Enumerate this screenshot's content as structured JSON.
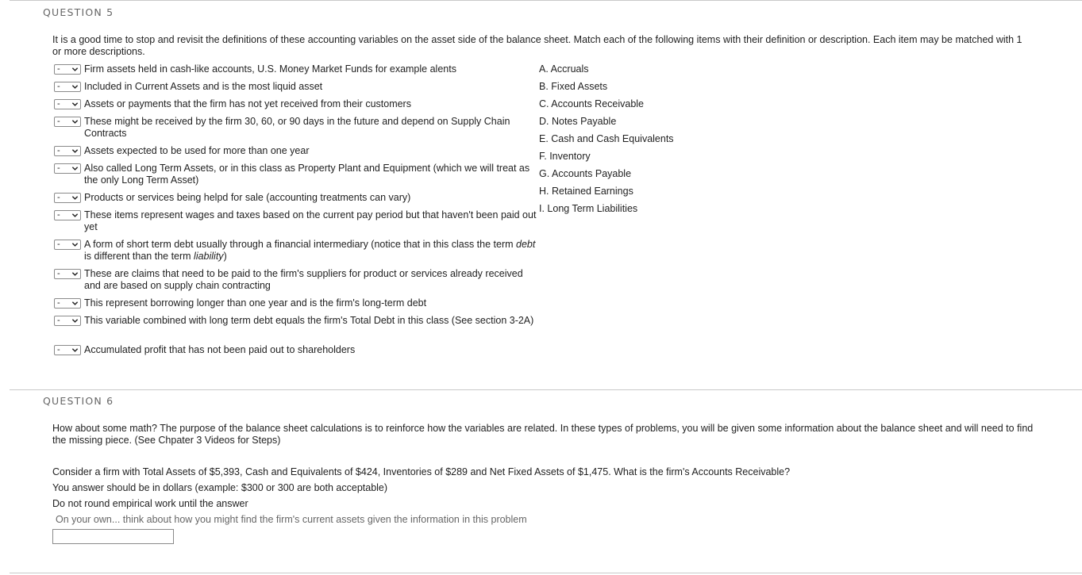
{
  "q5": {
    "heading": "QUESTION 5",
    "instructions": "It is a good time to stop and revisit the definitions of these accounting variables on the asset side of the balance sheet.  Match each of the following items with their definition or description.  Each item may be matched with 1 or more descriptions.",
    "select_value": "-",
    "items": [
      {
        "text": "Firm assets held in cash-like accounts, U.S. Money Market Funds for example alents"
      },
      {
        "text": "Included in Current Assets and is the most liquid asset"
      },
      {
        "text": "Assets or payments that the firm has not yet received from their customers"
      },
      {
        "text": "These might be received by the firm 30, 60, or 90 days in the future and depend on Supply Chain Contracts"
      },
      {
        "text": "Assets expected to be used for more than one year"
      },
      {
        "text": "Also called Long Term Assets, or in this class as Property Plant and Equipment (which we will treat as the only Long Term Asset)"
      },
      {
        "text": "Products or services being helpd for sale (accounting treatments can vary)"
      },
      {
        "text": "These items represent wages and taxes based on the current pay period but that haven't been paid out yet"
      },
      {
        "text_a": "A form of short term debt usually through a financial intermediary (notice that in this class the term ",
        "em_a": "debt",
        "text_b": " is different than the term ",
        "em_b": "liability",
        "text_c": ")"
      },
      {
        "text": "These are claims that need to be paid to the firm's suppliers for product or services already received and are based on supply chain contracting"
      },
      {
        "text": "This represent borrowing longer than one year and is the firm's long-term debt"
      },
      {
        "text": "This variable combined with long term debt equals the firm's Total Debt in this class (See section 3-2A)"
      },
      {
        "text": "Accumulated profit that has not been paid out to shareholders"
      }
    ],
    "options": [
      "A. Accruals",
      "B. Fixed Assets",
      "C. Accounts Receivable",
      "D. Notes Payable",
      "E. Cash and Cash Equivalents",
      "F. Inventory",
      "G. Accounts Payable",
      "H. Retained Earnings",
      "I.  Long Term Liabilities"
    ]
  },
  "q6": {
    "heading": "QUESTION 6",
    "intro": "How about some math?  The purpose of the balance sheet calculations is to reinforce how the variables are related.  In these types of problems, you will be given some information about the balance sheet and will need to find the missing piece.  (See Chpater 3 Videos for Steps)",
    "problem": "Consider a firm with Total Assets of $5,393, Cash and Equivalents of $424, Inventories of $289 and Net Fixed Assets of $1,475.  What is the firm's Accounts Receivable?",
    "format_note": "You answer should be in dollars (example: $300 or 300 are both acceptable)",
    "rounding_note": "Do not round empirical work until the answer",
    "hint": "On your own... think about how you might find the firm's current assets given the information in this problem",
    "answer_value": ""
  }
}
